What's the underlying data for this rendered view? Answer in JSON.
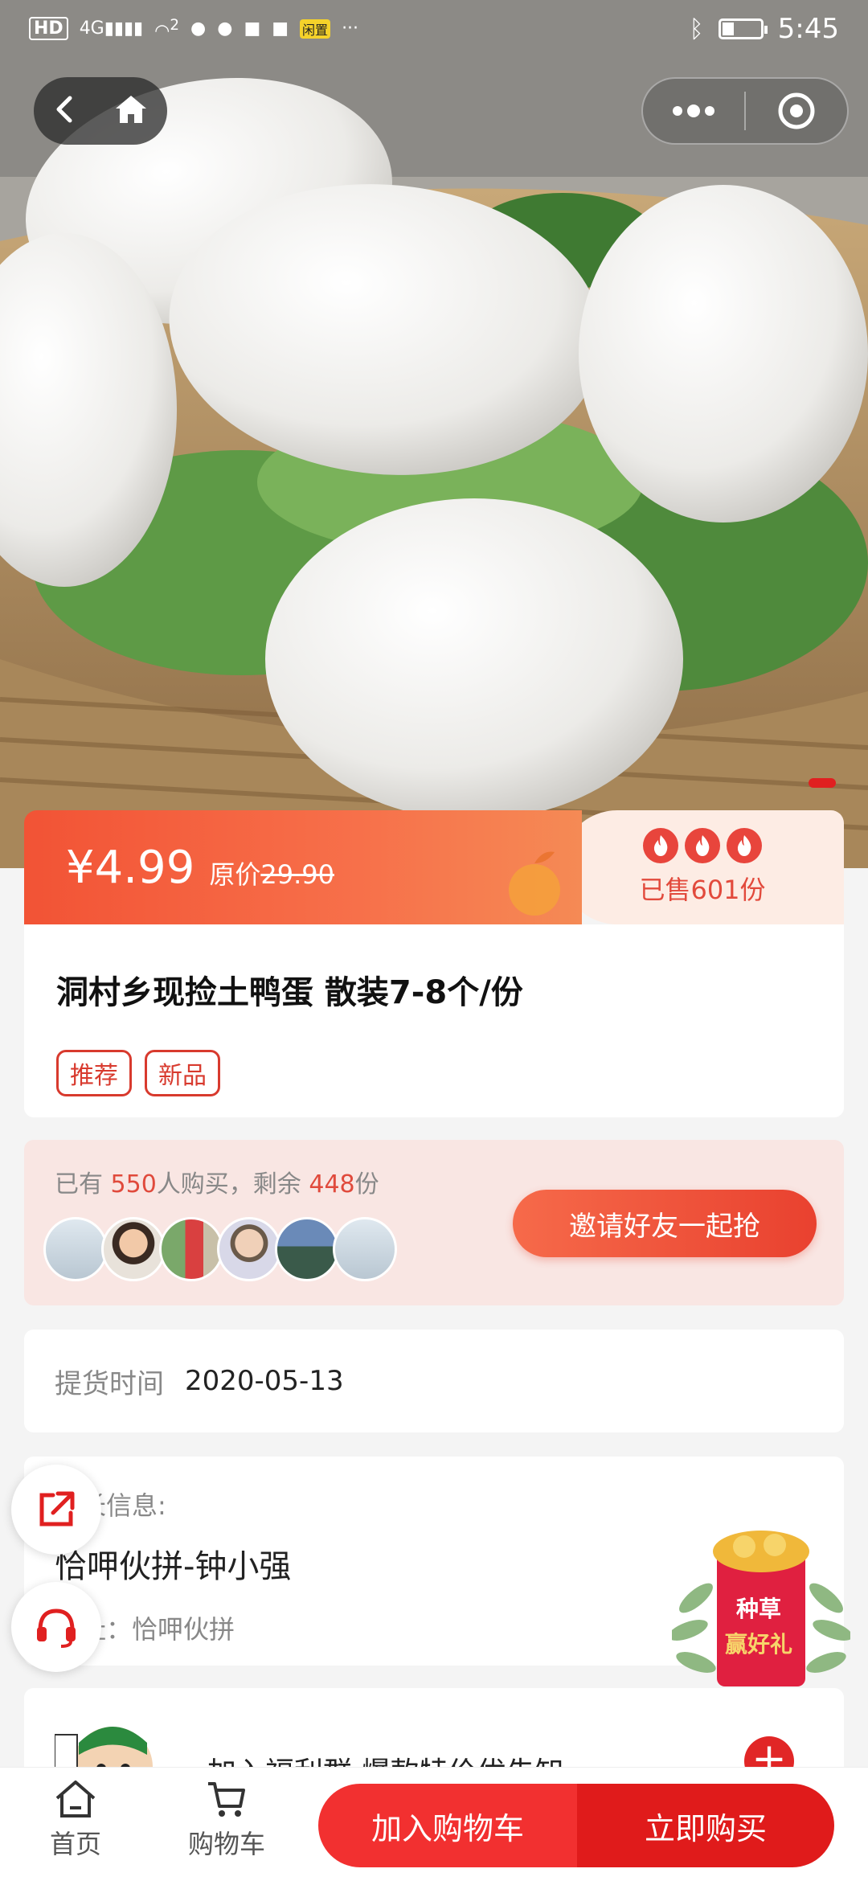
{
  "status_bar": {
    "network_label": "HD",
    "signal_label": "4G",
    "wifi_label": "2",
    "app_badge": "闲置",
    "more": "···",
    "time": "5:45"
  },
  "price": {
    "current": "¥4.99",
    "original_label": "原价",
    "original_value": "29.90",
    "sold": "已售601份"
  },
  "product": {
    "title": "洞村乡现捡土鸭蛋 散装7-8个/份",
    "tags": [
      "推荐",
      "新品"
    ]
  },
  "group_buy": {
    "prefix": "已有",
    "buyers": "550",
    "mid": "人购买，剩余",
    "remaining": "448",
    "suffix": "份",
    "invite_label": "邀请好友一起抢"
  },
  "pickup": {
    "label": "提货时间",
    "value": "2020-05-13"
  },
  "leader": {
    "label": "团长信息:",
    "name": "恰呷伙拼-钟小强",
    "address": "地址：恰呷伙拼"
  },
  "join_group": {
    "text": "加入福利群 爆款特价优先知"
  },
  "redpacket": {
    "line1": "种草",
    "line2": "赢好礼"
  },
  "bottom_bar": {
    "home_label": "首页",
    "cart_label": "购物车",
    "add_to_cart": "加入购物车",
    "buy_now": "立即购买"
  },
  "colors": {
    "accent": "#e01b1b",
    "price_gradient_start": "#f25335",
    "highlight": "#e04a3c"
  }
}
